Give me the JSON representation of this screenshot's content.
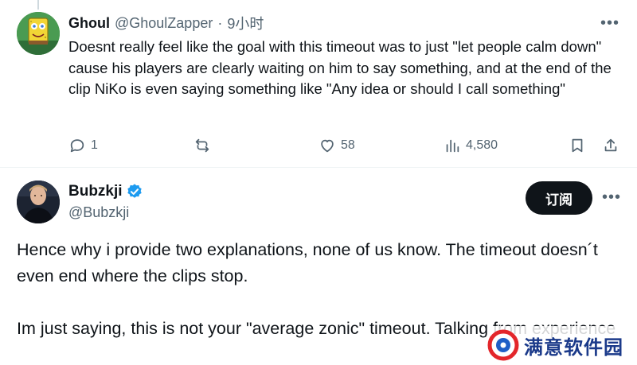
{
  "reply": {
    "display_name": "Ghoul",
    "handle": "@GhoulZapper",
    "separator": "·",
    "time": "9小时",
    "more_icon": "more-horizontal-icon",
    "text": "Doesnt really feel like the goal with this timeout was to just \"let people calm down\" cause his players are clearly waiting on him to say something, and at the end of the clip NiKo is even saying something like \"Any idea or should I call something\"",
    "actions": {
      "reply_count": "1",
      "retweet_count": "",
      "like_count": "58",
      "view_count": "4,580"
    }
  },
  "main": {
    "display_name": "Bubzkji",
    "handle": "@Bubzkji",
    "verified": true,
    "verified_color": "#1d9bf0",
    "subscribe_label": "订阅",
    "paragraphs": [
      "Hence why i provide two explanations, none of us know. The timeout doesn´t even end where the clips stop.",
      "Im just saying, this is not your \"average zonic\" timeout. Talking from experience"
    ]
  },
  "watermark": {
    "text": "满意软件园"
  },
  "colors": {
    "text": "#0f1419",
    "muted": "#536471",
    "divider": "#eff3f4",
    "button_bg": "#0f1419"
  }
}
